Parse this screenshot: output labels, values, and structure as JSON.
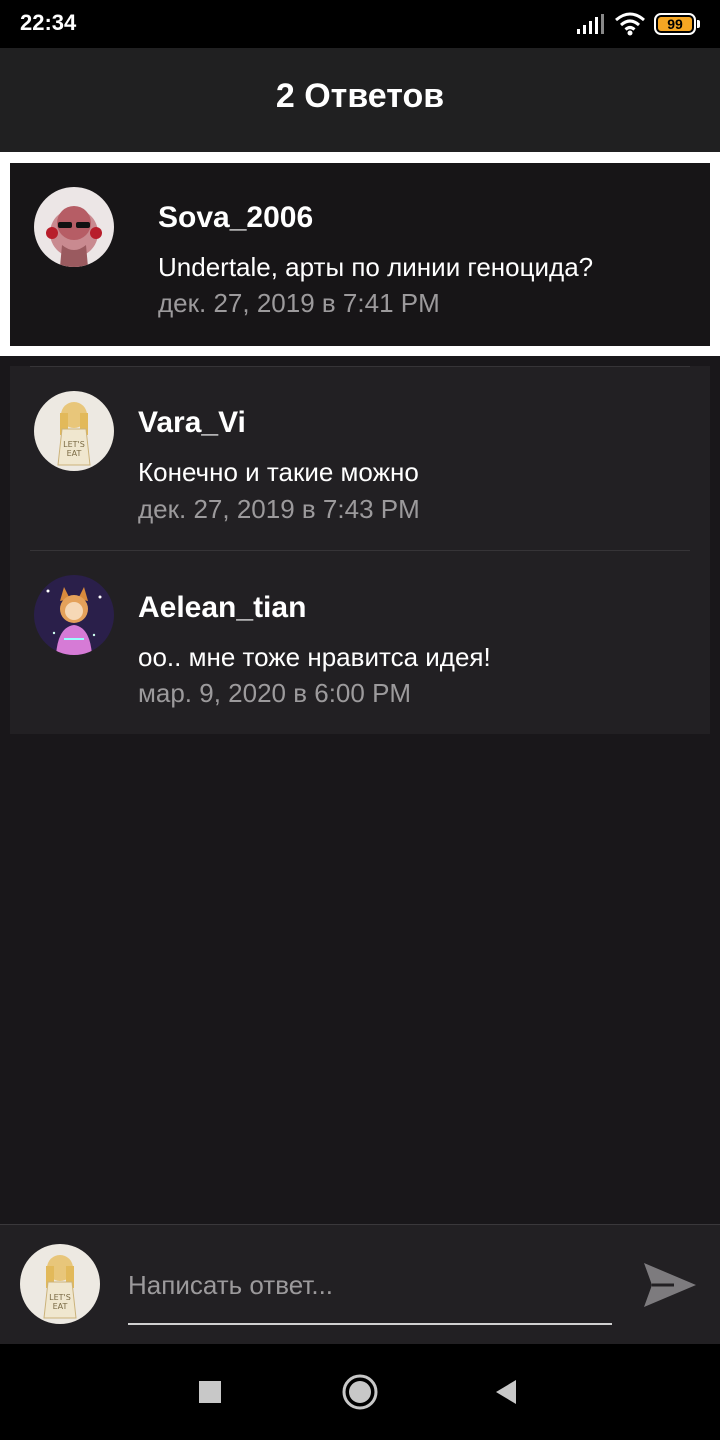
{
  "status_bar": {
    "time": "22:34",
    "battery_level": "99",
    "icons": [
      "signal-icon",
      "wifi-icon",
      "battery-icon"
    ]
  },
  "header": {
    "title": "2 Ответов"
  },
  "original_post": {
    "author": "Sova_2006",
    "text": "Undertale, арты по линии геноцида?",
    "date": "дек. 27, 2019 в 7:41 PM"
  },
  "replies": [
    {
      "author": "Vara_Vi",
      "text": "Конечно и такие можно",
      "date": "дек. 27, 2019 в 7:43 PM"
    },
    {
      "author": "Aelean_tian",
      "text": "оо.. мне тоже нравитса идея!",
      "date": "мар. 9, 2020 в 6:00 PM"
    }
  ],
  "composer": {
    "placeholder": "Написать ответ...",
    "send_icon": "send-icon"
  },
  "nav_bar": {
    "icons": [
      "recents-icon",
      "home-icon",
      "back-icon"
    ]
  },
  "colors": {
    "background": "#19171a",
    "header": "#202021",
    "card": "#222023",
    "muted_text": "#9c9a9c",
    "battery": "#f5a623"
  }
}
